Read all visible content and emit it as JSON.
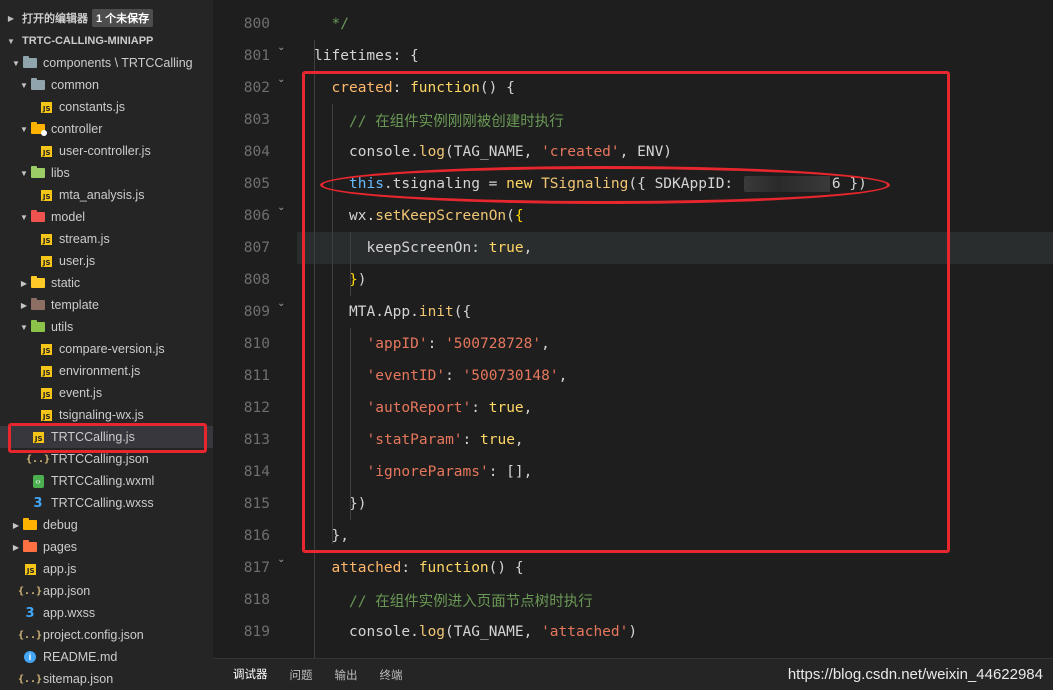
{
  "sidebar": {
    "open_editors_label": "打开的编辑器",
    "unsaved_badge": "1 个未保存",
    "project_name": "TRTC-CALLING-MINIAPP",
    "items": [
      {
        "label": "components \\ TRTCCalling",
        "type": "folder",
        "color": "#90a4ae",
        "expanded": true,
        "depth": 1
      },
      {
        "label": "common",
        "type": "folder",
        "color": "#90a4ae",
        "expanded": true,
        "depth": 2
      },
      {
        "label": "constants.js",
        "type": "js",
        "depth": 3
      },
      {
        "label": "controller",
        "type": "folder",
        "color": "#ffb300",
        "expanded": true,
        "depth": 2,
        "dot": "#ffffff"
      },
      {
        "label": "user-controller.js",
        "type": "js",
        "depth": 3
      },
      {
        "label": "libs",
        "type": "folder",
        "color": "#9ccc65",
        "expanded": true,
        "depth": 2
      },
      {
        "label": "mta_analysis.js",
        "type": "js",
        "depth": 3
      },
      {
        "label": "model",
        "type": "folder",
        "color": "#ef5350",
        "expanded": true,
        "depth": 2
      },
      {
        "label": "stream.js",
        "type": "js",
        "depth": 3
      },
      {
        "label": "user.js",
        "type": "js",
        "depth": 3
      },
      {
        "label": "static",
        "type": "folder",
        "color": "#ffca28",
        "expanded": false,
        "depth": 2
      },
      {
        "label": "template",
        "type": "folder",
        "color": "#8d6e63",
        "expanded": false,
        "depth": 2
      },
      {
        "label": "utils",
        "type": "folder",
        "color": "#8bc34a",
        "expanded": true,
        "depth": 2
      },
      {
        "label": "compare-version.js",
        "type": "js",
        "depth": 3
      },
      {
        "label": "environment.js",
        "type": "js",
        "depth": 3
      },
      {
        "label": "event.js",
        "type": "js",
        "depth": 3
      },
      {
        "label": "tsignaling-wx.js",
        "type": "js",
        "depth": 3
      },
      {
        "label": "TRTCCalling.js",
        "type": "js",
        "depth": 2,
        "selected": true
      },
      {
        "label": "TRTCCalling.json",
        "type": "json",
        "depth": 2
      },
      {
        "label": "TRTCCalling.wxml",
        "type": "wxml",
        "depth": 2
      },
      {
        "label": "TRTCCalling.wxss",
        "type": "css",
        "depth": 2
      },
      {
        "label": "debug",
        "type": "folder",
        "color": "#ffb300",
        "expanded": false,
        "depth": 1
      },
      {
        "label": "pages",
        "type": "folder",
        "color": "#ff7043",
        "expanded": false,
        "depth": 1
      },
      {
        "label": "app.js",
        "type": "js",
        "depth": 1
      },
      {
        "label": "app.json",
        "type": "json",
        "depth": 1
      },
      {
        "label": "app.wxss",
        "type": "css",
        "depth": 1
      },
      {
        "label": "project.config.json",
        "type": "json",
        "depth": 1
      },
      {
        "label": "README.md",
        "type": "md",
        "depth": 1
      },
      {
        "label": "sitemap.json",
        "type": "json",
        "depth": 1
      }
    ]
  },
  "editor": {
    "lines": [
      {
        "num": "800",
        "indent": 1,
        "fold": false,
        "tokens": [
          [
            "cmt",
            "*/"
          ]
        ]
      },
      {
        "num": "801",
        "indent": 0,
        "fold": true,
        "tokens": [
          [
            "plain",
            "lifetimes: {"
          ]
        ]
      },
      {
        "num": "802",
        "indent": 1,
        "fold": true,
        "tokens": [
          [
            "prop",
            "created"
          ],
          [
            "plain",
            ": "
          ],
          [
            "kw",
            "function"
          ],
          [
            "plain",
            "() {"
          ]
        ]
      },
      {
        "num": "803",
        "indent": 2,
        "fold": false,
        "tokens": [
          [
            "cmt",
            "// 在组件实例刚刚被创建时执行"
          ]
        ]
      },
      {
        "num": "804",
        "indent": 2,
        "fold": false,
        "tokens": [
          [
            "plain",
            "console."
          ],
          [
            "fn",
            "log"
          ],
          [
            "plain",
            "(TAG_NAME, "
          ],
          [
            "str",
            "'created'"
          ],
          [
            "plain",
            ", ENV)"
          ]
        ]
      },
      {
        "num": "805",
        "indent": 2,
        "fold": false,
        "tokens": [
          [
            "blue",
            "this"
          ],
          [
            "plain",
            ".tsignaling = "
          ],
          [
            "kw",
            "new"
          ],
          [
            "plain",
            " "
          ],
          [
            "fn",
            "TSignaling"
          ],
          [
            "plain",
            "({ SDKAppID: "
          ],
          [
            "blur",
            ""
          ],
          [
            "plain",
            "6 })"
          ]
        ]
      },
      {
        "num": "806",
        "indent": 2,
        "fold": true,
        "tokens": [
          [
            "plain",
            "wx."
          ],
          [
            "fn",
            "setKeepScreenOn"
          ],
          [
            "plain",
            "("
          ],
          [
            "bracket",
            "{"
          ]
        ]
      },
      {
        "num": "807",
        "indent": 3,
        "fold": false,
        "current": true,
        "tokens": [
          [
            "plain",
            "keepScreenOn: "
          ],
          [
            "kw",
            "true"
          ],
          [
            "plain",
            ","
          ]
        ]
      },
      {
        "num": "808",
        "indent": 2,
        "fold": false,
        "tokens": [
          [
            "bracket",
            "}"
          ],
          [
            "plain",
            ")"
          ]
        ]
      },
      {
        "num": "809",
        "indent": 2,
        "fold": true,
        "tokens": [
          [
            "plain",
            "MTA.App."
          ],
          [
            "fn",
            "init"
          ],
          [
            "plain",
            "({"
          ]
        ]
      },
      {
        "num": "810",
        "indent": 3,
        "fold": false,
        "tokens": [
          [
            "str",
            "'appID'"
          ],
          [
            "plain",
            ": "
          ],
          [
            "str",
            "'500728728'"
          ],
          [
            "plain",
            ","
          ]
        ]
      },
      {
        "num": "811",
        "indent": 3,
        "fold": false,
        "tokens": [
          [
            "str",
            "'eventID'"
          ],
          [
            "plain",
            ": "
          ],
          [
            "str",
            "'500730148'"
          ],
          [
            "plain",
            ","
          ]
        ]
      },
      {
        "num": "812",
        "indent": 3,
        "fold": false,
        "tokens": [
          [
            "str",
            "'autoReport'"
          ],
          [
            "plain",
            ": "
          ],
          [
            "kw",
            "true"
          ],
          [
            "plain",
            ","
          ]
        ]
      },
      {
        "num": "813",
        "indent": 3,
        "fold": false,
        "tokens": [
          [
            "str",
            "'statParam'"
          ],
          [
            "plain",
            ": "
          ],
          [
            "kw",
            "true"
          ],
          [
            "plain",
            ","
          ]
        ]
      },
      {
        "num": "814",
        "indent": 3,
        "fold": false,
        "tokens": [
          [
            "str",
            "'ignoreParams'"
          ],
          [
            "plain",
            ": [],"
          ]
        ]
      },
      {
        "num": "815",
        "indent": 2,
        "fold": false,
        "tokens": [
          [
            "plain",
            "})"
          ]
        ]
      },
      {
        "num": "816",
        "indent": 1,
        "fold": false,
        "tokens": [
          [
            "plain",
            "},"
          ]
        ]
      },
      {
        "num": "817",
        "indent": 1,
        "fold": true,
        "tokens": [
          [
            "prop",
            "attached"
          ],
          [
            "plain",
            ": "
          ],
          [
            "kw",
            "function"
          ],
          [
            "plain",
            "() {"
          ]
        ]
      },
      {
        "num": "818",
        "indent": 2,
        "fold": false,
        "tokens": [
          [
            "cmt",
            "// 在组件实例进入页面节点树时执行"
          ]
        ]
      },
      {
        "num": "819",
        "indent": 2,
        "fold": false,
        "tokens": [
          [
            "plain",
            "console."
          ],
          [
            "fn",
            "log"
          ],
          [
            "plain",
            "(TAG_NAME, "
          ],
          [
            "str",
            "'attached'"
          ],
          [
            "plain",
            ")"
          ]
        ]
      }
    ]
  },
  "panel": {
    "tabs": [
      "调试器",
      "问题",
      "输出",
      "终端"
    ],
    "active_tab": 0
  },
  "watermark": "https://blog.csdn.net/weixin_44622984",
  "colors": {
    "annotation": "#e8262d",
    "keyword": "#ffd866",
    "string": "#e6775d",
    "comment": "#6a9955"
  }
}
